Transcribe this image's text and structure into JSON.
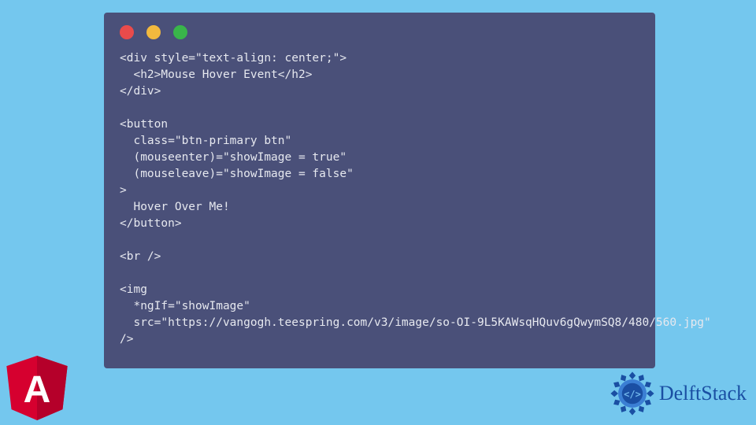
{
  "code": {
    "lines": [
      "<div style=\"text-align: center;\">",
      "  <h2>Mouse Hover Event</h2>",
      "</div>",
      "",
      "<button",
      "  class=\"btn-primary btn\"",
      "  (mouseenter)=\"showImage = true\"",
      "  (mouseleave)=\"showImage = false\"",
      ">",
      "  Hover Over Me!",
      "</button>",
      "",
      "<br />",
      "",
      "<img",
      "  *ngIf=\"showImage\"",
      "  src=\"https://vangogh.teespring.com/v3/image/so-OI-9L5KAWsqHQuv6gQwymSQ8/480/560.jpg\"",
      "/>"
    ]
  },
  "branding": {
    "angular_letter": "A",
    "delftstack_label": "DelftStack"
  }
}
